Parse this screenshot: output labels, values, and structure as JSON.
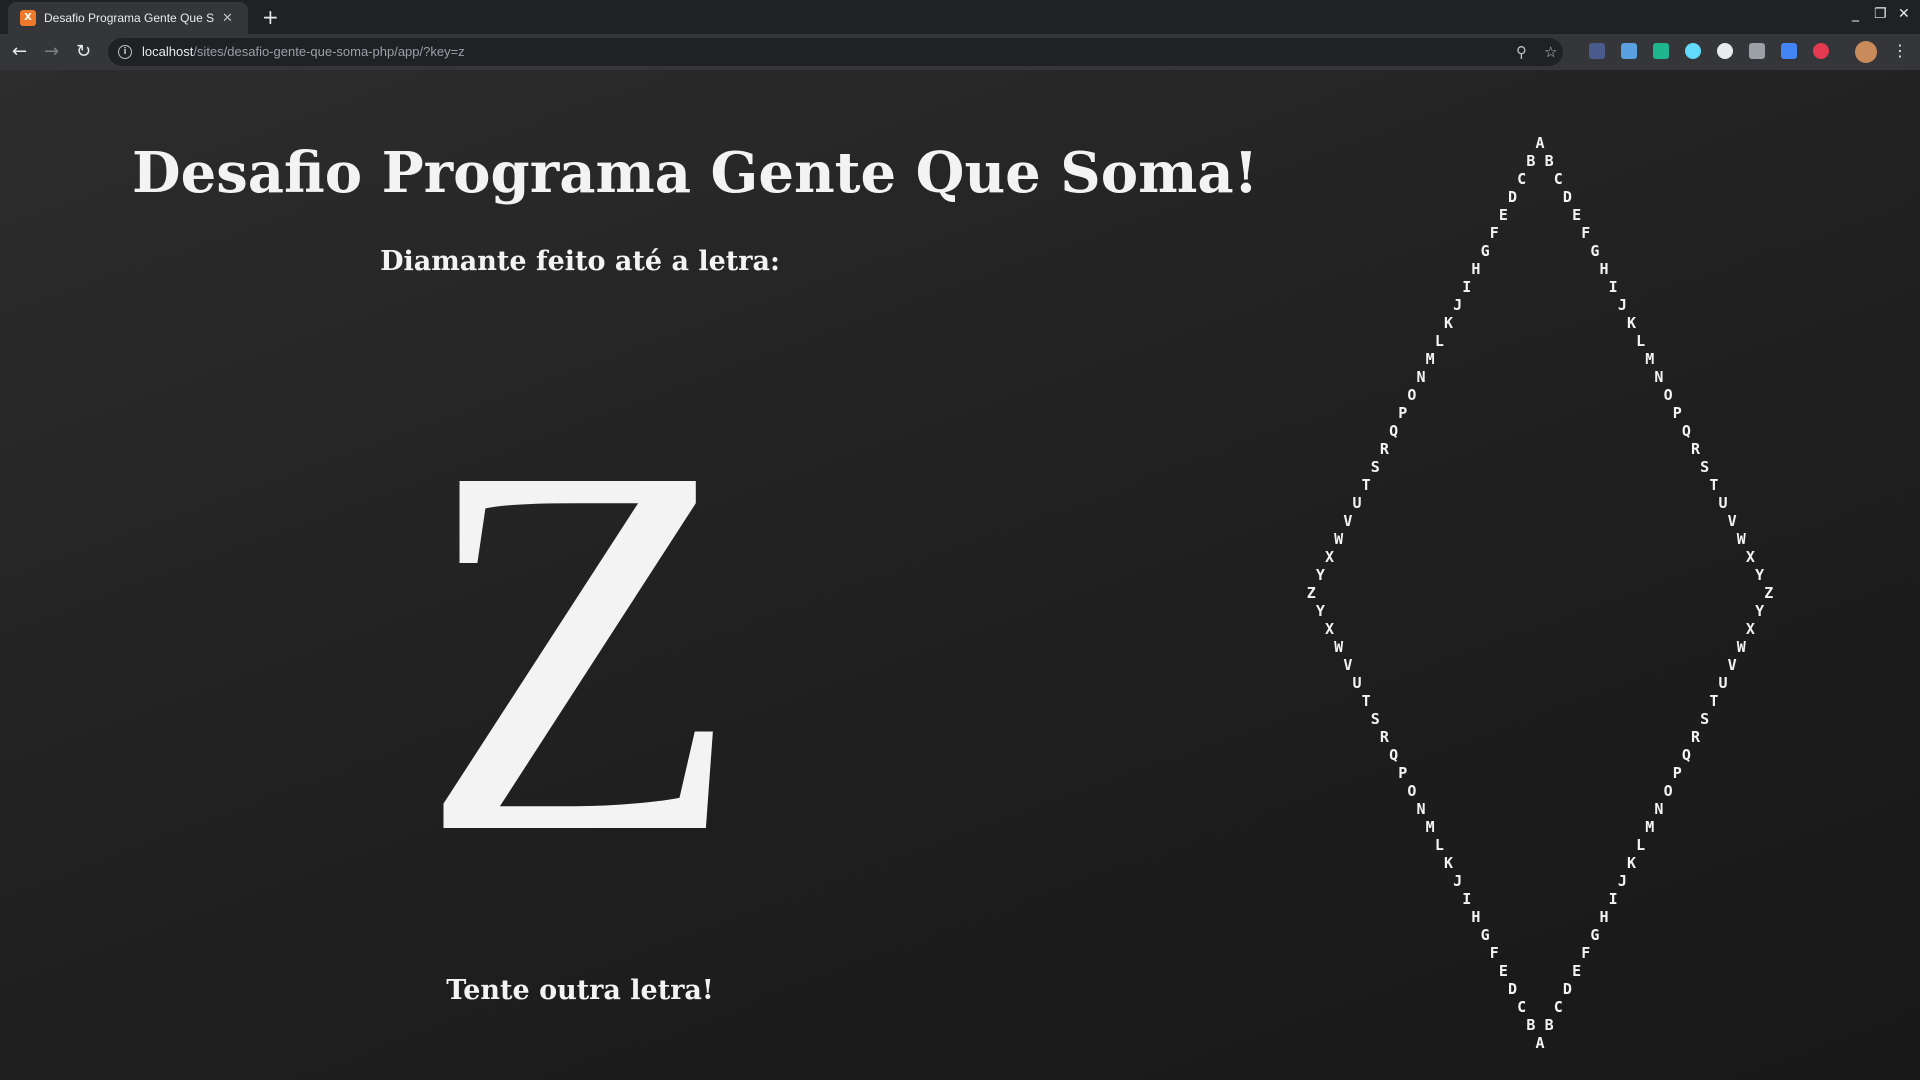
{
  "browser": {
    "tab_title": "Desafio Programa Gente Que Soma!",
    "tab_favicon_text": "X",
    "new_tab_symbol": "+",
    "close_symbol": "✕",
    "url_host": "localhost",
    "url_path": "/sites/desafio-gente-que-soma-php/app/?key=z",
    "window_controls": [
      "_",
      "❐",
      "✕"
    ]
  },
  "page": {
    "title": "Desafio Programa Gente Que Soma!",
    "subtitle": "Diamante feito até a letra:",
    "letter": "Z",
    "retry_text": "Tente outra letra!"
  },
  "diamond": {
    "top_row": "A",
    "letters": [
      "A",
      "B",
      "C",
      "D",
      "E",
      "F",
      "G",
      "H",
      "I",
      "J",
      "K",
      "L",
      "M",
      "N",
      "O",
      "P",
      "Q",
      "R",
      "S",
      "T",
      "U",
      "V",
      "W",
      "X",
      "Y",
      "Z"
    ]
  }
}
